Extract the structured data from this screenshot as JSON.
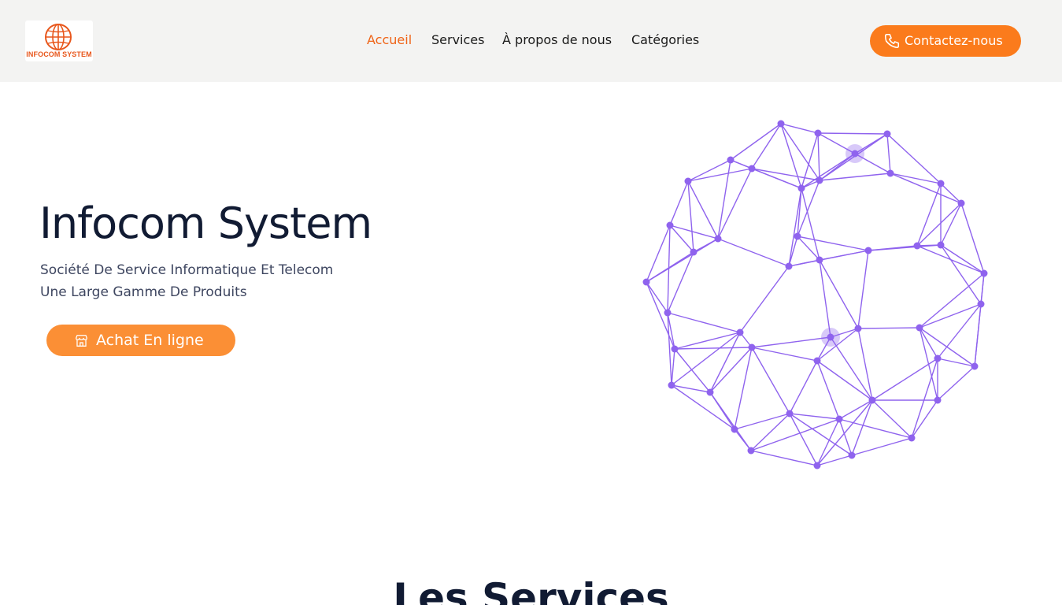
{
  "header": {
    "logo_text": "INFOCOM SYSTEM",
    "nav": [
      {
        "label": "Accueil",
        "active": true
      },
      {
        "label": "Services",
        "active": false
      },
      {
        "label": "À propos de nous",
        "active": false
      },
      {
        "label": "Catégories",
        "active": false
      }
    ],
    "contact_label": "Contactez-nous"
  },
  "hero": {
    "title": "Infocom System",
    "subtitle_1": "Société De Service Informatique Et Telecom",
    "subtitle_2": "Une Large Gamme De Produits",
    "buy_label": "Achat En ligne",
    "illustration": "network-globe"
  },
  "services": {
    "title": "Les Services"
  },
  "colors": {
    "accent": "#fb7b1c",
    "accent_light": "#fb8f35",
    "nav_active": "#ef6418",
    "header_bg": "#f3f3f2",
    "network": "#8f63ee",
    "text_dark": "#111b33"
  }
}
